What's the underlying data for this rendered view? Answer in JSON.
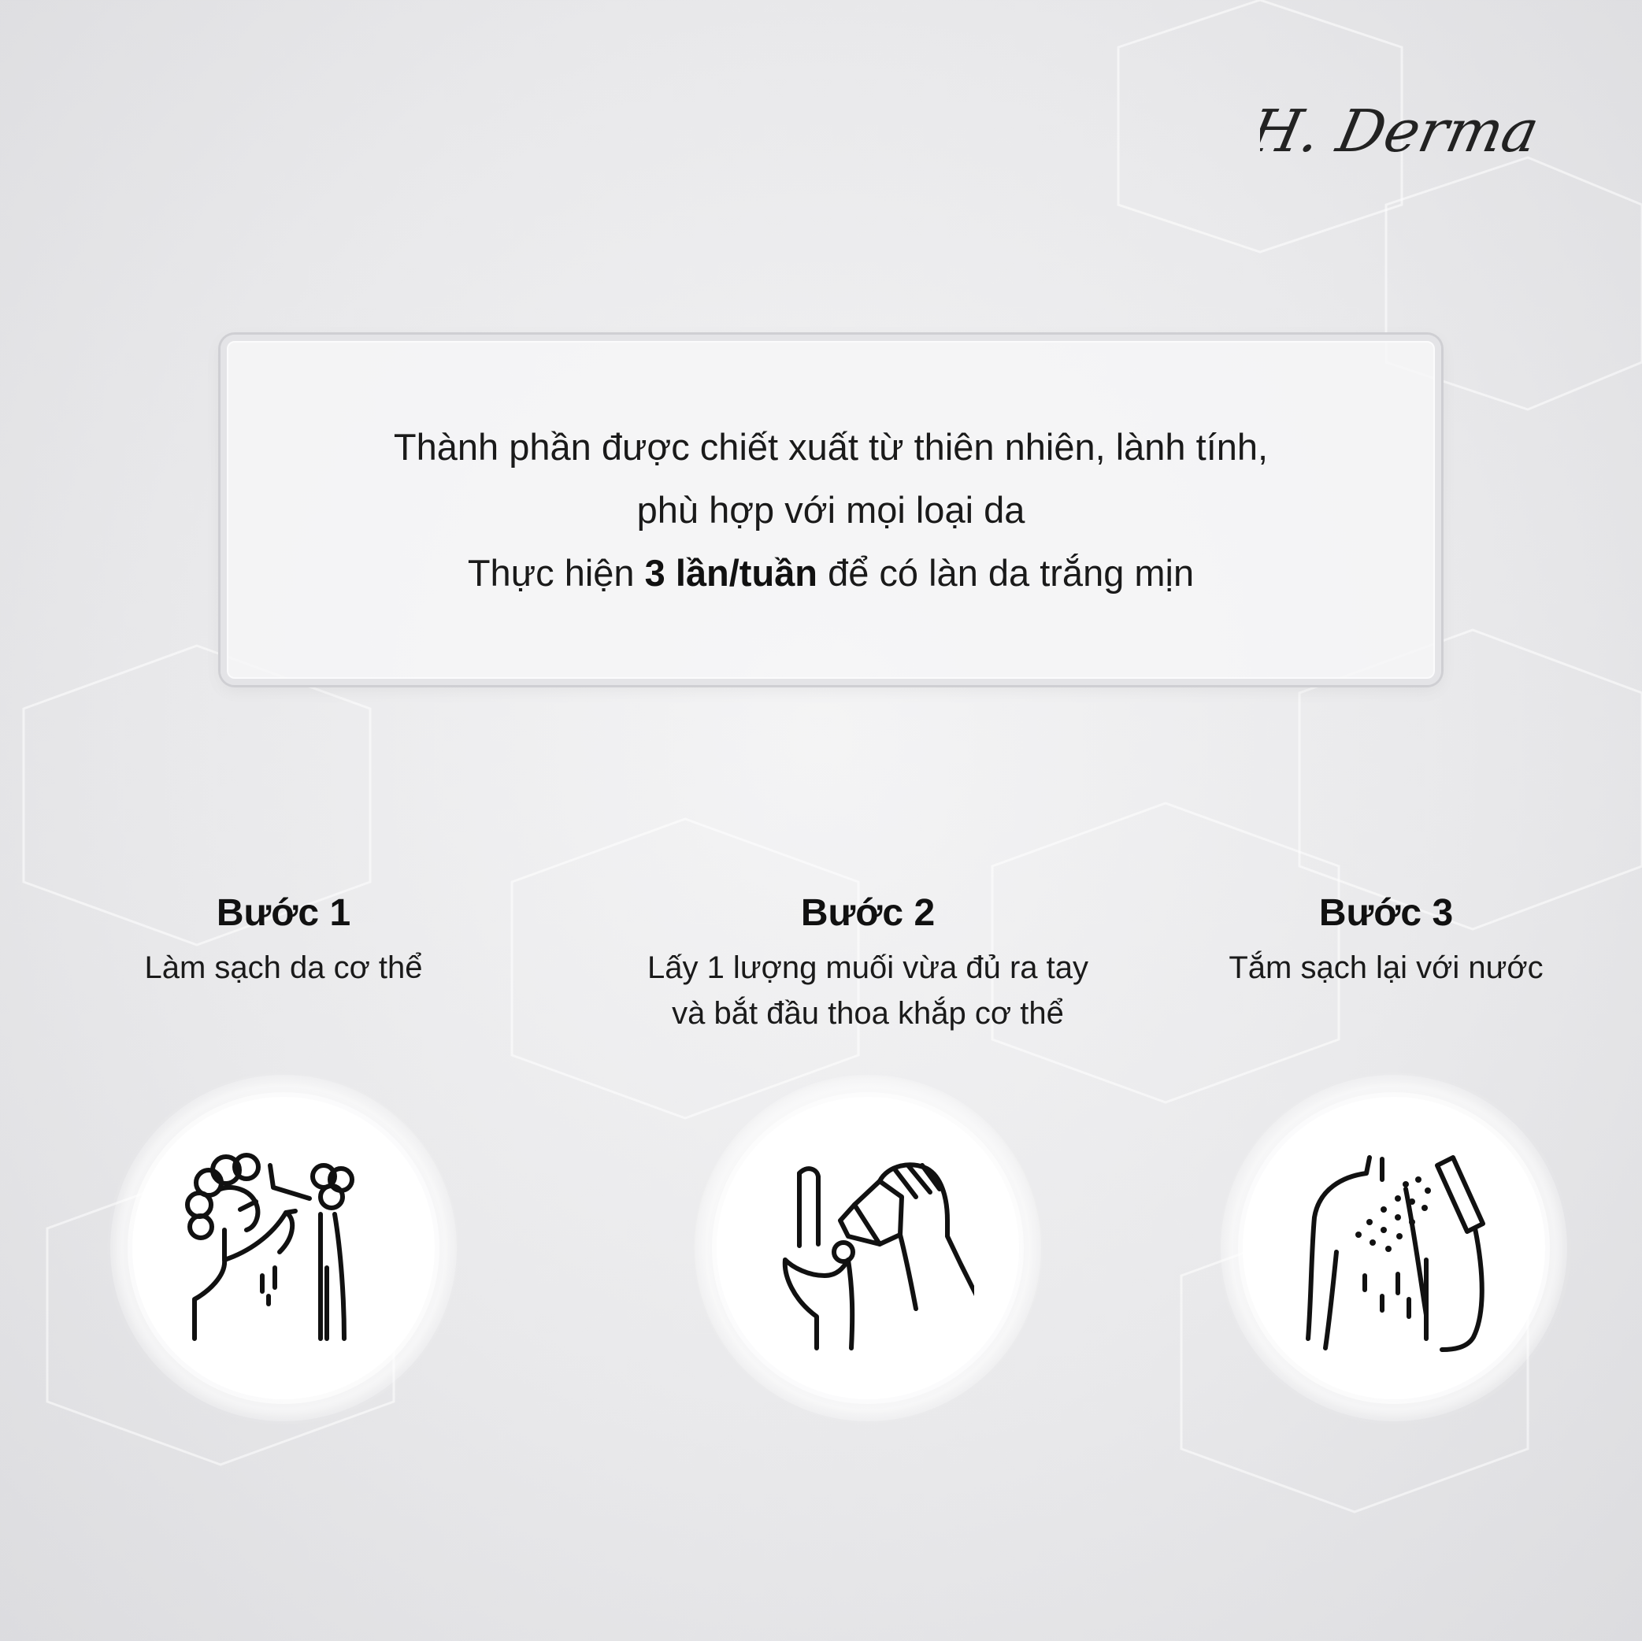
{
  "brand": {
    "logo_text": "H. Derma"
  },
  "info": {
    "line1": "Thành phần được chiết xuất từ thiên nhiên, lành tính,",
    "line2": "phù hợp với mọi loại da",
    "line3_prefix": "Thực hiện ",
    "line3_bold": "3 lần/tuần",
    "line3_suffix": " để có làn da trắng mịn"
  },
  "steps": [
    {
      "title": "Bước 1",
      "desc_lines": [
        "Làm sạch da cơ thể"
      ],
      "icon": "soap-washing-body-icon"
    },
    {
      "title": "Bước 2",
      "desc_lines": [
        "Lấy 1 lượng muối vừa đủ ra tay",
        "và bắt đầu thoa khắp cơ thể"
      ],
      "icon": "pour-salt-hand-icon"
    },
    {
      "title": "Bước 3",
      "desc_lines": [
        "Tắm sạch lại với nước"
      ],
      "icon": "shower-rinse-icon"
    }
  ],
  "colors": {
    "background": "#e9e9eb",
    "text": "#111111",
    "card": "#ffffff"
  }
}
